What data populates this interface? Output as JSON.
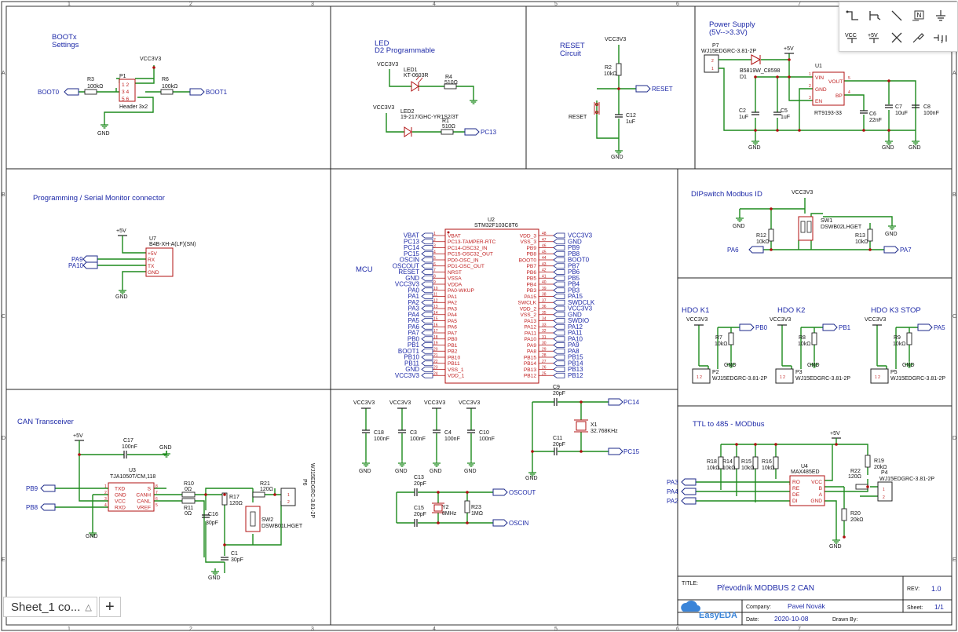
{
  "frame": {
    "cols": [
      "1",
      "2",
      "3",
      "4",
      "5",
      "6",
      "7"
    ],
    "rows": [
      "A",
      "B",
      "C",
      "D",
      "E"
    ]
  },
  "sections": {
    "boot": {
      "title": "BOOTx",
      "subtitle": "Settings"
    },
    "led": {
      "title": "LED",
      "subtitle": "D2 Programmable"
    },
    "reset": {
      "title": "RESET",
      "subtitle": "Circuit"
    },
    "power": {
      "title": "Power Supply",
      "subtitle": "(5V-->3.3V)"
    },
    "prog": {
      "title": "Programming / Serial Monitor connector"
    },
    "mcu": {
      "title": "MCU"
    },
    "dip": {
      "title": "DIPswitch Modbus ID"
    },
    "hdo1": {
      "title": "HDO K1"
    },
    "hdo2": {
      "title": "HDO K2"
    },
    "hdo3": {
      "title": "HDO K3 STOP"
    },
    "can": {
      "title": "CAN Transceiver"
    },
    "ttl": {
      "title": "TTL to 485 - MODbus"
    }
  },
  "boot": {
    "vcc": "VCC3V3",
    "p1": "P1",
    "header": "Header 3x2",
    "pins": [
      "1 2",
      "3 4",
      "5 6"
    ],
    "r3": "R3",
    "r3v": "100kΩ",
    "r6": "R6",
    "r6v": "100kΩ",
    "boot0": "BOOT0",
    "boot1": "BOOT1",
    "gnd": "GND"
  },
  "led": {
    "vcc1": "VCC3V3",
    "led1": "LED1",
    "led1v": "KT-0603R",
    "r4": "R4",
    "r4v": "510Ω",
    "vcc2": "VCC3V3",
    "led2": "LED2",
    "led2v": "19-217/GHC-YR1S2/3T",
    "r1": "R1",
    "r1v": "510Ω",
    "pc13": "PC13"
  },
  "reset": {
    "vcc": "VCC3V3",
    "r2": "R2",
    "r2v": "10kΩ",
    "net": "RESET",
    "sw": "RESET",
    "c12": "C12",
    "c12v": "1uF",
    "gnd": "GND"
  },
  "power": {
    "p7": "P7",
    "p7v": "WJ15EDGRC-3.81-2P",
    "p7pins": [
      "2",
      "1"
    ],
    "d1": "D1",
    "d1v": "B5819W_C8598",
    "plus5": "+5V",
    "u1": "U1",
    "u1v": "RT9193-33",
    "u1pins": [
      "VIN",
      "GND",
      "EN",
      "VOUT",
      "BP"
    ],
    "u1pinnums": [
      "1",
      "2",
      "3",
      "5",
      "4"
    ],
    "c2": "C2",
    "c2v": "1uF",
    "c5": "C5",
    "c5v": "1uF",
    "c6": "C6",
    "c6v": "22nF",
    "c7": "C7",
    "c7v": "10uF",
    "c8": "C8",
    "c8v": "100nF",
    "gnd": "GND"
  },
  "prog": {
    "plus5": "+5V",
    "u7": "U7",
    "u7v": "B4B-XH-A(LF)(SN)",
    "pins": [
      "+5V",
      "RX",
      "TX",
      "GND"
    ],
    "pa9": "PA9",
    "pa10": "PA10",
    "gnd": "GND"
  },
  "mcu": {
    "ref": "U2",
    "part": "STM32F103C8T6",
    "left_nets": [
      "VBAT",
      "PC13",
      "PC14",
      "PC15",
      "OSCIN",
      "OSCOUT",
      "RESET",
      "GND",
      "VCC3V3",
      "PA0",
      "PA1",
      "PA2",
      "PA3",
      "PA4",
      "PA5",
      "PA6",
      "PA7",
      "PB0",
      "PB1",
      "BOOT1",
      "PB10",
      "PB11",
      "GND",
      "VCC3V3"
    ],
    "left_pins": [
      "VBAT",
      "PC13-TAMPER-RTC",
      "PC14-OSC32_IN",
      "PC15-OSC32_OUT",
      "PD0-OSC_IN",
      "PD1-OSC_OUT",
      "NRST",
      "VSSA",
      "VDDA",
      "PA0-WKUP",
      "PA1",
      "PA2",
      "PA3",
      "PA4",
      "PA5",
      "PA6",
      "PA7",
      "PB0",
      "PB1",
      "PB2",
      "PB10",
      "PB11",
      "VSS_1",
      "VDD_1"
    ],
    "right_pins": [
      "VDD_3",
      "VSS_3",
      "PB9",
      "PB8",
      "BOOT0",
      "PB7",
      "PB6",
      "PB5",
      "PB4",
      "PB3",
      "PA15",
      "SWCLK",
      "VDD_2",
      "VSS_2",
      "PA13",
      "PA12",
      "PA11",
      "PA10",
      "PA9",
      "PA8",
      "PB15",
      "PB14",
      "PB13",
      "PB12"
    ],
    "right_nets": [
      "VCC3V3",
      "GND",
      "PB9",
      "PB8",
      "BOOT0",
      "PB7",
      "PB6",
      "PB5",
      "PB4",
      "PB3",
      "PA15",
      "SWDCLK",
      "VCC3V3",
      "GND",
      "SWDIO",
      "PA12",
      "PA11",
      "PA10",
      "PA9",
      "PA8",
      "PB15",
      "PB14",
      "PB13",
      "PB12"
    ]
  },
  "decoupling": {
    "vcc": "VCC3V3",
    "gnd": "GND",
    "caps": [
      {
        "ref": "C18",
        "val": "100nF"
      },
      {
        "ref": "C3",
        "val": "100nF"
      },
      {
        "ref": "C4",
        "val": "100nF"
      },
      {
        "ref": "C10",
        "val": "100nF"
      }
    ]
  },
  "xtal32": {
    "c9": "C9",
    "c9v": "20pF",
    "c11": "C11",
    "c11v": "20pF",
    "x1": "X1",
    "x1v": "32.768KHz",
    "pc14": "PC14",
    "pc15": "PC15",
    "gnd": "GND"
  },
  "xtal8": {
    "c13": "C13",
    "c13v": "20pF",
    "c15": "C15",
    "c15v": "20pF",
    "y2": "Y2",
    "y2v": "8MHz",
    "r23": "R23",
    "r23v": "1MΩ",
    "oscout": "OSCOUT",
    "oscin": "OSCIN"
  },
  "dip": {
    "vcc": "VCC3V3",
    "sw1": "SW1",
    "sw1v": "DSWB02LHGET",
    "r12": "R12",
    "r12v": "10kΩ",
    "r13": "R13",
    "r13v": "10kΩ",
    "pa6": "PA6",
    "pa7": "PA7",
    "gnd": "GND"
  },
  "hdo": [
    {
      "vcc": "VCC3V3",
      "r": "R7",
      "rv": "10kΩ",
      "p": "P2",
      "pv": "WJ15EDGRC-3.81-2P",
      "net": "PB0",
      "gnd": "GND"
    },
    {
      "vcc": "VCC3V3",
      "r": "R8",
      "rv": "10kΩ",
      "p": "P3",
      "pv": "WJ15EDGRC-3.81-2P",
      "net": "PB1",
      "gnd": "GND"
    },
    {
      "vcc": "VCC3V3",
      "r": "R9",
      "rv": "10kΩ",
      "p": "P5",
      "pv": "WJ15EDGRC-3.81-2P",
      "net": "PA5",
      "gnd": "GND"
    }
  ],
  "can": {
    "plus5": "+5V",
    "c17": "C17",
    "c17v": "100nF",
    "gnd": "GND",
    "u3": "U3",
    "u3v": "TJA1050T/CM,118",
    "lpins": [
      "TXD",
      "GND",
      "VCC",
      "RXD"
    ],
    "lnums": [
      "1",
      "2",
      "3",
      "4"
    ],
    "rpins": [
      "S",
      "CANH",
      "CANL",
      "VREF"
    ],
    "rnums": [
      "8",
      "7",
      "6",
      "5"
    ],
    "pb9": "PB9",
    "pb8": "PB8",
    "r10": "R10",
    "r10v": "0Ω",
    "r11": "R11",
    "r11v": "0Ω",
    "r17": "R17",
    "r17v": "120Ω",
    "r21": "R21",
    "r21v": "120Ω",
    "c16": "C16",
    "c16v": "30pF",
    "c1": "C1",
    "c1v": "30pF",
    "sw2": "SW2",
    "sw2v": "DSWB01LHGET",
    "p6": "P6",
    "p6v": "WJ15EDGRC-3.81-2P"
  },
  "ttl": {
    "plus5": "+5V",
    "res": [
      {
        "ref": "R18",
        "val": "10kΩ"
      },
      {
        "ref": "R14",
        "val": "10kΩ"
      },
      {
        "ref": "R15",
        "val": "10kΩ"
      },
      {
        "ref": "R16",
        "val": "10kΩ"
      }
    ],
    "u4": "U4",
    "u4v": "MAX485ED",
    "lpins": [
      "RO",
      "RE",
      "DE",
      "DI"
    ],
    "rpins": [
      "VCC",
      "B",
      "A",
      "GND"
    ],
    "r19": "R19",
    "r19v": "20kΩ",
    "r20": "R20",
    "r20v": "20kΩ",
    "r22": "R22",
    "r22v": "120Ω",
    "p4": "P4",
    "p4v": "WJ15EDGRC-3.81-2P",
    "pa3": "PA3",
    "pa4": "PA4",
    "pa2": "PA2",
    "gnd": "GND"
  },
  "titleblock": {
    "title_label": "TITLE:",
    "title": "Převodník MODBUS 2 CAN",
    "rev_label": "REV:",
    "rev": "1.0",
    "company_label": "Company:",
    "company": "Pavel Novák",
    "sheet_label": "Sheet:",
    "sheet": "1/1",
    "date_label": "Date:",
    "date": "2020-10-08",
    "drawn_label": "Drawn By:",
    "logo": "EasyEDA"
  },
  "toolbar": {
    "icons": [
      "wire-tool-icon",
      "bus-tool-icon",
      "line-tool-icon",
      "netlabel-tool-icon",
      "ground-tool-icon",
      "vcc-tool-icon",
      "plus5v-tool-icon",
      "no-connect-icon",
      "pin-tool-icon",
      "netflag-tool-icon"
    ],
    "vcc": "VCC",
    "plus5": "+5V"
  },
  "tabs": {
    "sheet": "Sheet_1 co...",
    "add": "+"
  },
  "colors": {
    "wire": "#1d8a1d",
    "frame": "#1a1a1a",
    "blue": "#2e4bb0",
    "part": "#b01010",
    "pin": "#d44a4a",
    "net": "#1e2aa8"
  }
}
